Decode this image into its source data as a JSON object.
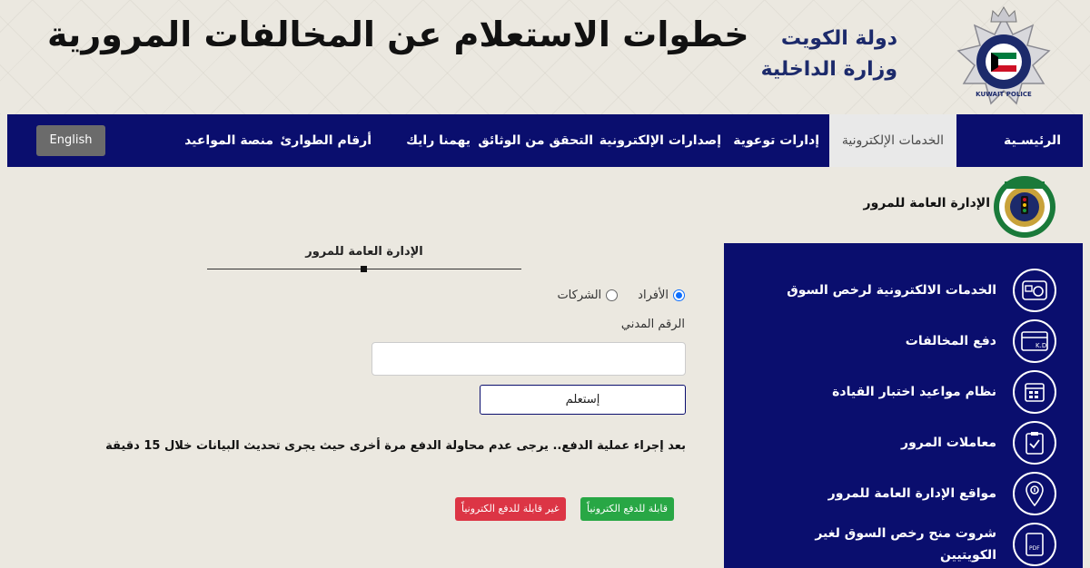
{
  "header": {
    "heading": "خطوات الاستعلام عن المخالفات المرورية",
    "state_line1": "دولة الكويت",
    "state_line2": "وزارة الداخلية",
    "logo_text": "KUWAIT POLICE"
  },
  "nav": {
    "items": [
      {
        "label": "الرئيسـية",
        "active": false
      },
      {
        "label": "الخدمات الإلكترونية",
        "active": true
      },
      {
        "label": "إدارات توعوية",
        "active": false
      },
      {
        "label": "إصدارات الإلكترونية",
        "active": false
      },
      {
        "label": "التحقق من الوثائق",
        "active": false
      },
      {
        "label": "يهمنا رايك",
        "active": false
      },
      {
        "label": "أرقام الطوارئ",
        "active": false
      },
      {
        "label": "منصة المواعيد",
        "active": false
      }
    ],
    "language_button": "English"
  },
  "department": {
    "title": "الإدارة العامة للمرور"
  },
  "sidebar": {
    "items": [
      {
        "label": "الخدمات الالكترونية لرخص السوق",
        "icon": "license-card-icon"
      },
      {
        "label": "دفع المخالفات",
        "icon": "payment-card-icon",
        "icon_text": "K.D"
      },
      {
        "label": "نظام مواعيد اختبار القيادة",
        "icon": "calendar-icon"
      },
      {
        "label": "معاملات المرور",
        "icon": "clipboard-check-icon"
      },
      {
        "label": "مواقع الإدارة العامة للمرور",
        "icon": "location-pin-icon"
      },
      {
        "label": "شروت منح رخص السوق لغير الكويتيين",
        "icon": "pdf-document-icon",
        "icon_text": "PDF"
      }
    ]
  },
  "form": {
    "title": "الإدارة العامة للمرور",
    "radio_individuals": "الأفراد",
    "radio_companies": "الشركات",
    "selected": "individuals",
    "civil_id_label": "الرقم المدني",
    "civil_id_value": "",
    "submit_label": "إستعلم",
    "payment_note": "بعد إجراء عملية الدفع.. يرجى عدم محاولة الدفع مرة أخرى حيث يجرى تحديث البيانات خلال 15 دقيقة",
    "badge_payable": "قابلة للدفع الكترونياً",
    "badge_not_payable": "غير قابلة للدفع الكترونياً"
  },
  "colors": {
    "navy": "#0a0e6e",
    "page_bg": "#ebe8e0",
    "green": "#28a745",
    "red": "#dc3545",
    "lang_button": "#6b6b6b"
  }
}
